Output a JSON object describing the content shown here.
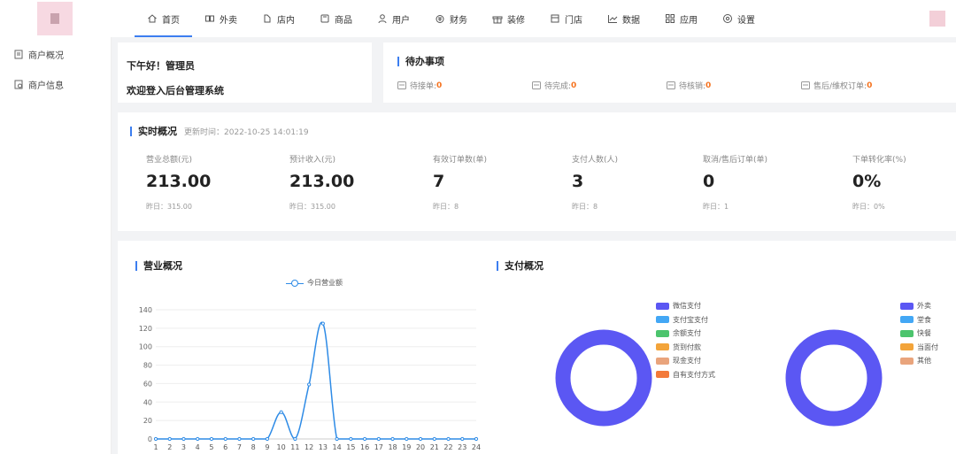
{
  "nav": {
    "items": [
      {
        "label": "首页",
        "icon": "home-icon",
        "active": true
      },
      {
        "label": "外卖",
        "icon": "takeout-icon"
      },
      {
        "label": "店内",
        "icon": "dine-in-icon"
      },
      {
        "label": "商品",
        "icon": "goods-icon"
      },
      {
        "label": "用户",
        "icon": "user-icon"
      },
      {
        "label": "财务",
        "icon": "finance-icon"
      },
      {
        "label": "装修",
        "icon": "decoration-icon"
      },
      {
        "label": "门店",
        "icon": "store-icon"
      },
      {
        "label": "数据",
        "icon": "data-icon"
      },
      {
        "label": "应用",
        "icon": "apps-icon"
      },
      {
        "label": "设置",
        "icon": "settings-icon"
      }
    ]
  },
  "sidebar": {
    "items": [
      {
        "label": "商户概况",
        "icon": "merchant-overview-icon"
      },
      {
        "label": "商户信息",
        "icon": "merchant-info-icon"
      }
    ]
  },
  "greeting": {
    "line1": "下午好！管理员",
    "line2": "欢迎登入后台管理系统"
  },
  "todo": {
    "title": "待办事项",
    "items": [
      {
        "label": "待接单:",
        "value": "0"
      },
      {
        "label": "待完成:",
        "value": "0"
      },
      {
        "label": "待核销:",
        "value": "0"
      },
      {
        "label": "售后/维权订单:",
        "value": "0"
      }
    ]
  },
  "realtime": {
    "title": "实时概况",
    "updated": "更新时间：2022-10-25 14:01:19",
    "stats": [
      {
        "label": "营业总额(元)",
        "value": "213.00",
        "yesterday": "昨日：315.00"
      },
      {
        "label": "预计收入(元)",
        "value": "213.00",
        "yesterday": "昨日：315.00"
      },
      {
        "label": "有效订单数(单)",
        "value": "7",
        "yesterday": "昨日：8"
      },
      {
        "label": "支付人数(人)",
        "value": "3",
        "yesterday": "昨日：8"
      },
      {
        "label": "取消/售后订单(单)",
        "value": "0",
        "yesterday": "昨日：1"
      },
      {
        "label": "下单转化率(%)",
        "value": "0%",
        "yesterday": "昨日：0%"
      }
    ]
  },
  "business": {
    "title": "营业概况"
  },
  "payment": {
    "title": "支付概况"
  },
  "chart_data": [
    {
      "type": "line",
      "title": "营业概况",
      "x": [
        "1",
        "2",
        "3",
        "4",
        "5",
        "6",
        "7",
        "8",
        "9",
        "10",
        "11",
        "12",
        "13",
        "14",
        "15",
        "16",
        "17",
        "18",
        "19",
        "20",
        "21",
        "22",
        "23",
        "24"
      ],
      "series": [
        {
          "name": "今日营业额",
          "color": "#2e8be6",
          "values": [
            0,
            0,
            0,
            0,
            0,
            0,
            0,
            0,
            0,
            29,
            0,
            59,
            125,
            0,
            0,
            0,
            0,
            0,
            0,
            0,
            0,
            0,
            0,
            0
          ]
        }
      ],
      "yticks": [
        0,
        20,
        40,
        60,
        80,
        100,
        120,
        140
      ],
      "ylim": [
        0,
        140
      ],
      "grid": true,
      "legend": "top"
    },
    {
      "type": "pie",
      "legend": "top-left of ring",
      "slices": [
        {
          "name": "微信支付",
          "color": "#5b57f3",
          "value": 100
        },
        {
          "name": "支付宝支付",
          "color": "#43a7f5",
          "value": 0
        },
        {
          "name": "余额支付",
          "color": "#4cc46d",
          "value": 0
        },
        {
          "name": "货到付款",
          "color": "#f3a43a",
          "value": 0
        },
        {
          "name": "现金支付",
          "color": "#e9a47c",
          "value": 0
        },
        {
          "name": "自有支付方式",
          "color": "#f37a3a",
          "value": 0
        }
      ]
    },
    {
      "type": "pie",
      "legend": "top-right",
      "slices": [
        {
          "name": "外卖",
          "color": "#5b57f3",
          "value": 100
        },
        {
          "name": "堂食",
          "color": "#43a7f5",
          "value": 0
        },
        {
          "name": "快餐",
          "color": "#4cc46d",
          "value": 0
        },
        {
          "name": "当面付",
          "color": "#f3a43a",
          "value": 0
        },
        {
          "name": "其他",
          "color": "#e9a47c",
          "value": 0
        }
      ]
    }
  ]
}
